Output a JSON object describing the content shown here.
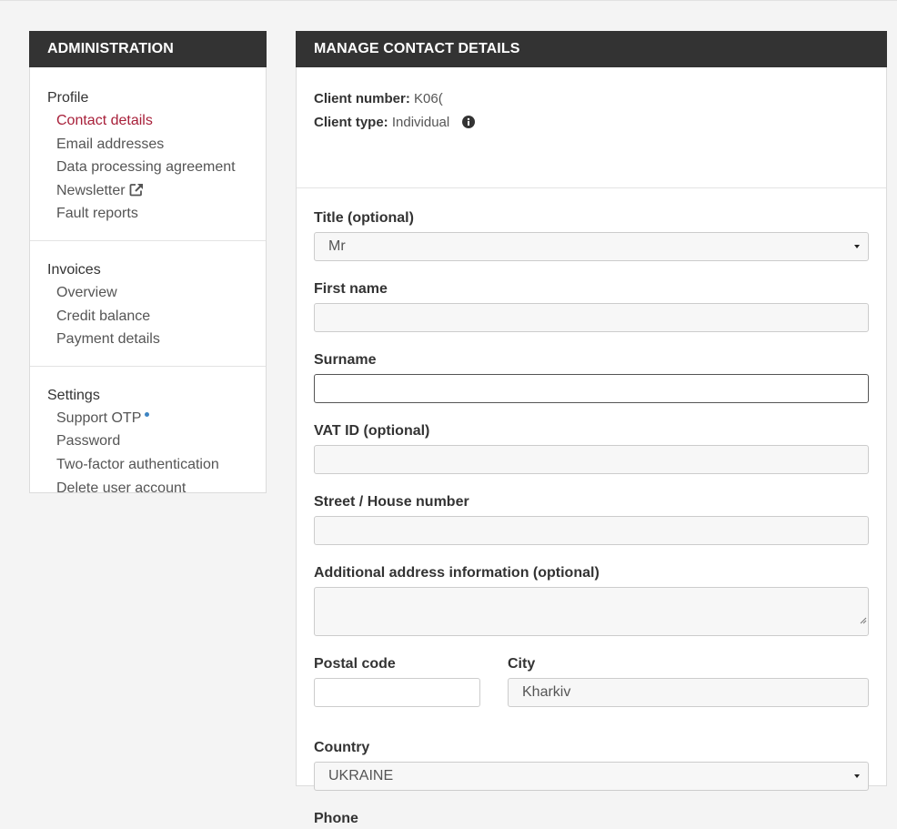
{
  "sidebar": {
    "header": "ADMINISTRATION",
    "sections": [
      {
        "title": "Profile",
        "items": [
          "Contact details",
          "Email addresses",
          "Data processing agreement",
          "Newsletter",
          "Fault reports"
        ]
      },
      {
        "title": "Invoices",
        "items": [
          "Overview",
          "Credit balance",
          "Payment details"
        ]
      },
      {
        "title": "Settings",
        "items": [
          "Support OTP",
          "Password",
          "Two-factor authentication",
          "Delete user account"
        ]
      }
    ]
  },
  "main": {
    "header": "MANAGE CONTACT DETAILS",
    "client": {
      "number_label": "Client number:",
      "number_value": "K06(",
      "type_label": "Client type:",
      "type_value": "Individual"
    },
    "form": {
      "title_label": "Title (optional)",
      "title_value": "Mr",
      "first_name_label": "First name",
      "first_name_value": "",
      "surname_label": "Surname",
      "surname_value": "",
      "vat_label": "VAT ID (optional)",
      "vat_value": "",
      "street_label": "Street / House number",
      "street_value": "",
      "additional_label": "Additional address information (optional)",
      "additional_value": "",
      "postal_label": "Postal code",
      "postal_value": "",
      "city_label": "City",
      "city_value": "Kharkiv",
      "country_label": "Country",
      "country_value": "UKRAINE",
      "phone_label": "Phone"
    }
  },
  "colors": {
    "header_bg": "#333333",
    "active_link": "#a8203a",
    "otp_dot": "#3d84c2"
  }
}
